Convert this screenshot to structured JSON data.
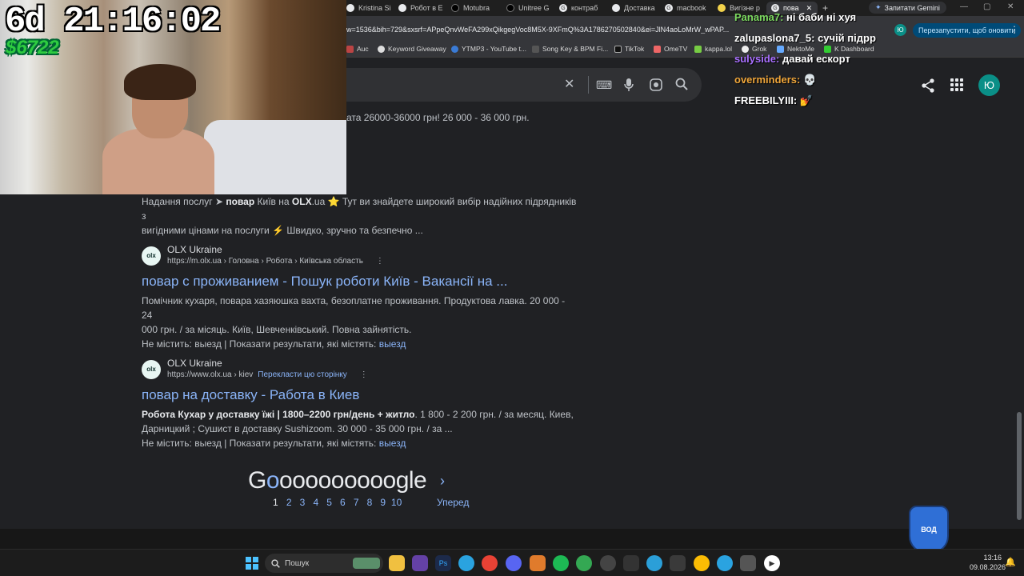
{
  "tabs": [
    "Kristina Si",
    "Робот в Е",
    "Motubra",
    "Unitree G",
    "контраб",
    "Доставка",
    "macbook",
    "Вигізне р",
    "пова"
  ],
  "gemini_label": "Запитати Gemini",
  "address": {
    "url": "w=1536&bih=729&sxsrf=APpeQnvWeFA299xQikgegVoc8M5X-9XFmQ%3A1786270502840&ei=JlN4aoLoMrW_wPAP...",
    "restart_label": "Перезапустити, щоб оновити",
    "profile_initial": "Ю"
  },
  "bookmarks": [
    "Auc",
    "Keyword Giveaway",
    "YTMP3 - YouTube t...",
    "Song Key & BPM Fi...",
    "TikTok",
    "OmeTV",
    "kappa.lol",
    "Grok",
    "NektoMe",
    "K Dashboard"
  ],
  "header": {
    "avatar": "Ю"
  },
  "stream": {
    "timer": "6d 21:16:02",
    "money": "$6722"
  },
  "chat": [
    {
      "user": "Panama7:",
      "msg": "ні баби ні хуя"
    },
    {
      "user": "zalupaslona7_5:",
      "msg": "сучій підрр"
    },
    {
      "user": "sulyside:",
      "msg": "давай ескорт"
    },
    {
      "user": "overminders:",
      "msg": "💀"
    },
    {
      "user": "FREEBILYIII:",
      "msg": "💅"
    }
  ],
  "results": {
    "partial_top": "лата 26000-36000 грн! 26 000 - 36 000 грн.",
    "olx_services": {
      "line1_a": "Надання послуг ➤ ",
      "line1_b": "повар",
      "line1_c": " Київ на ",
      "line1_d": "OLX",
      "line1_e": ".ua ⭐ Тут ви знайдете широкий вибір надійних підрядників з",
      "line2": "вигідними цінами на послуги ⚡ Швидко, зручно та безпечно ..."
    },
    "items": [
      {
        "site": "OLX Ukraine",
        "fav": "olx",
        "url": "https://m.olx.ua › Головна › Робота › Київська область",
        "translate": "",
        "title": "повар с проживанием - Пошук роботи Київ - Вакансії на ...",
        "snippet1": "Помічник кухаря, повара хазяюшка вахта, безоплатне проживання. Продуктова лавка. 20 000 - 24",
        "snippet2": "000 грн. / за місяць. Київ, Шевченківський. Повна зайнятість.",
        "missing_prefix": "Не містить: ",
        "missing_word": "выезд",
        "missing_mid": " | Показати результати, які містять: ",
        "missing_link": "выезд"
      },
      {
        "site": "OLX Ukraine",
        "fav": "olx",
        "url": "https://www.olx.ua › kiev",
        "translate": "Перекласти цю сторінку",
        "title": "повар на доставку - Работа в Киев",
        "snippet1_bold": "Робота Кухар у доставку їжі | 1800–2200 грн/день + житло",
        "snippet1_rest": ". 1 800 - 2 200 грн. / за месяц. Киев,",
        "snippet2": "Дарницкий ; Сушист в доставку Sushizoom. 30 000 - 35 000 грн. / за ...",
        "missing_prefix": "Не містить: ",
        "missing_word": "выезд",
        "missing_mid": " | Показати результати, які містять: ",
        "missing_link": "выезд"
      }
    ]
  },
  "pagination": {
    "logo_g": "G",
    "logo_o_first": "o",
    "logo_os": "ooooooooo",
    "logo_end": "gle",
    "pages": [
      "1",
      "2",
      "3",
      "4",
      "5",
      "6",
      "7",
      "8",
      "9",
      "10"
    ],
    "next": "Уперед"
  },
  "mascot_label": "ВОД",
  "taskbar": {
    "search_label": "Пошук",
    "time": "13:16",
    "date": "09.08.2026"
  }
}
